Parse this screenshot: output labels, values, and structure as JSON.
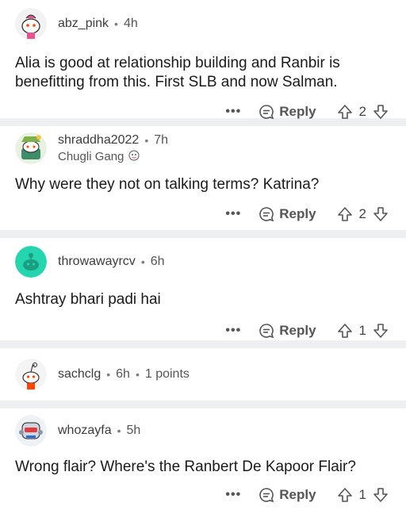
{
  "comments": [
    {
      "username": "abz_pink",
      "time": "4h",
      "avatar_icon": "snoo-pink-avatar-icon",
      "text": "Alia is good at relationship building and Ranbir is benefitting from this. First SLB and now Salman.",
      "reply_label": "Reply",
      "votes": "2"
    },
    {
      "username": "shraddha2022",
      "time": "7h",
      "flair": "Chugli Gang",
      "avatar_icon": "snoo-green-hat-avatar-icon",
      "text": "Why were they not on talking terms? Katrina?",
      "reply_label": "Reply",
      "votes": "2"
    },
    {
      "username": "throwawayrcv",
      "time": "6h",
      "avatar_icon": "snoo-default-teal-avatar-icon",
      "text": "Ashtray bhari padi hai",
      "reply_label": "Reply",
      "votes": "1"
    },
    {
      "username": "sachclg",
      "time": "6h",
      "points": "1 points",
      "avatar_icon": "snoo-plain-avatar-icon",
      "text": "",
      "collapsed": true
    },
    {
      "username": "whozayfa",
      "time": "5h",
      "avatar_icon": "snoo-robot-avatar-icon",
      "text": "Wrong flair? Where's the Ranbert De Kapoor Flair?",
      "reply_label": "Reply",
      "votes": "1"
    }
  ],
  "colors": {
    "separator": "#edeff1",
    "meta_text": "#555555",
    "teal_avatar": "#24d5b0"
  },
  "icons": {
    "more": "more-options-icon",
    "reply": "reply-bubble-icon",
    "upvote": "upvote-arrow-icon",
    "downvote": "downvote-arrow-icon"
  }
}
